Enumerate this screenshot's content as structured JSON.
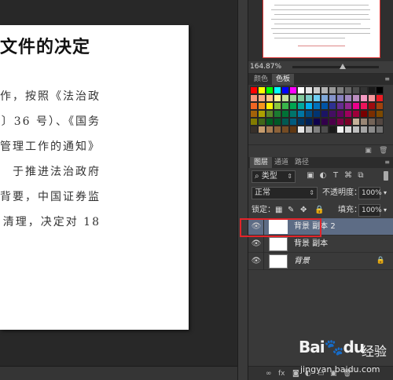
{
  "document": {
    "title": "文件的决定",
    "lines": [
      "作，按照《法治政",
      "〕36 号）、《国务",
      "管理工作的通知》",
      "于推进法治政府",
      "背要，中国证券监",
      "清理，决定对 18"
    ]
  },
  "navigator": {
    "zoom": "164.87%"
  },
  "swatches": {
    "tabs": [
      "颜色",
      "色板"
    ],
    "active_tab": "色板",
    "colors": [
      "#ff0000",
      "#ffff00",
      "#00ff00",
      "#00ffff",
      "#0000ff",
      "#ff00ff",
      "#ffffff",
      "#e6e6e6",
      "#cccccc",
      "#b3b3b3",
      "#999999",
      "#808080",
      "#666666",
      "#4d4d4d",
      "#333333",
      "#1a1a1a",
      "#000000",
      "#f7977a",
      "#f9ad81",
      "#fdc68a",
      "#fff79a",
      "#c4df9b",
      "#a3d39c",
      "#82ca9d",
      "#7bcdc8",
      "#6ecff6",
      "#7ea7d8",
      "#8493ca",
      "#8882be",
      "#a187be",
      "#bc8dbf",
      "#f49ac2",
      "#f6989d",
      "#ed1c24",
      "#f26522",
      "#f7941d",
      "#fff200",
      "#8dc73f",
      "#39b54a",
      "#00a651",
      "#00a99d",
      "#00aeef",
      "#0072bc",
      "#0054a6",
      "#2e3192",
      "#662d91",
      "#92278f",
      "#ec008c",
      "#ed145b",
      "#9e0b0f",
      "#a0410d",
      "#a36209",
      "#aba000",
      "#598527",
      "#1a7b30",
      "#007236",
      "#00746b",
      "#0076a3",
      "#004b80",
      "#003471",
      "#1b1464",
      "#440e62",
      "#630460",
      "#9e005d",
      "#9e0039",
      "#790000",
      "#7b2e00",
      "#7d4900",
      "#827b00",
      "#406618",
      "#005e20",
      "#005826",
      "#005952",
      "#005b7f",
      "#003663",
      "#002157",
      "#0d004c",
      "#32004b",
      "#4b0049",
      "#7b0046",
      "#7a0026",
      "#c7b299",
      "#998675",
      "#736357",
      "#534741",
      "#37302a",
      "#c69c6d",
      "#a67c52",
      "#8c6239",
      "#754c24",
      "#603813",
      "#e6e6e6",
      "#b3b3b3",
      "#808080",
      "#4d4d4d",
      "#1a1a1a",
      "#f5f5f5",
      "#d9d9d9",
      "#bfbfbf",
      "#a6a6a6",
      "#8c8c8c",
      "#737373"
    ]
  },
  "layers": {
    "tabs": [
      "图层",
      "通道",
      "路径"
    ],
    "active_tab": "图层",
    "filter": {
      "kind_icon": "⌕",
      "kind_label": "类型"
    },
    "blend_mode": "正常",
    "opacity_label": "不透明度：",
    "opacity_value": "100%",
    "lock_label": "锁定：",
    "fill_label": "填充：",
    "fill_value": "100%",
    "items": [
      {
        "name": "背景 副本 2",
        "selected": true
      },
      {
        "name": "背景 副本",
        "selected": false
      },
      {
        "name": "背景",
        "selected": false,
        "locked": true
      }
    ]
  },
  "watermark": {
    "logo": "Bai",
    "logo_suffix": "du",
    "jingyan": "经验",
    "url": "jingyan.baidu.com"
  }
}
